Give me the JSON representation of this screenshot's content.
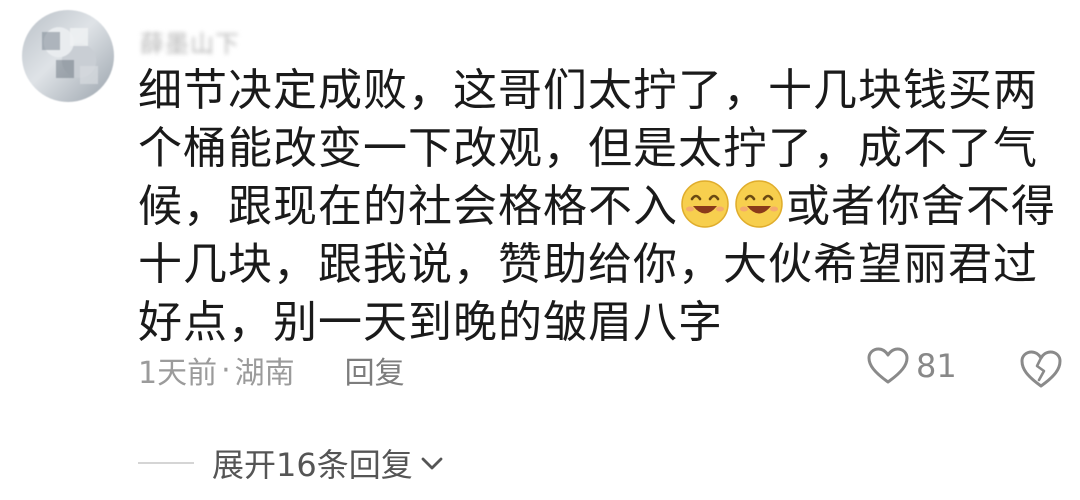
{
  "comment": {
    "username": "薛墨山下",
    "text_before_emoji": "细节决定成败，这哥们太拧了，十几块钱买两个桶能改变一下改观，但是太拧了，成不了气候，跟现在的社会格格不入",
    "text_after_emoji": "或者你舍不得十几块，跟我说，赞助给你，大伙希望丽君过好点，别一天到晚的皱眉八字",
    "time": "1天前",
    "separator": "·",
    "location": "湖南",
    "reply_label": "回复",
    "like_count": "81",
    "expand_label": "展开16条回复"
  },
  "colors": {
    "text": "#1a1a1a",
    "meta": "#9b9b9b",
    "emoji_face": "#f7cf4e"
  },
  "icons": [
    "avatar",
    "laughing-emoji",
    "heart-icon",
    "broken-heart-icon",
    "chevron-down-icon"
  ]
}
